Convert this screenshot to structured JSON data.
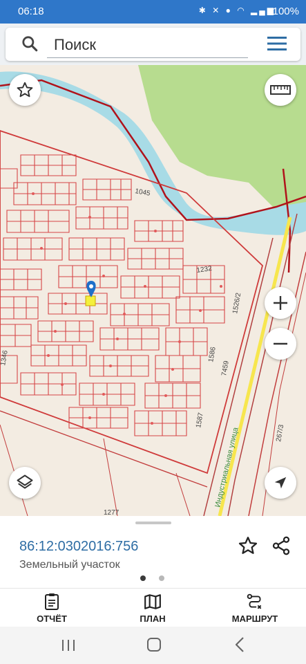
{
  "status_bar": {
    "time": "06:18",
    "icons": [
      "bluetooth-icon",
      "mute-icon",
      "location-icon",
      "wifi-icon",
      "signal-icon-1",
      "signal-icon-2"
    ],
    "battery": "100%"
  },
  "search": {
    "placeholder": "Поиск"
  },
  "map": {
    "labels": [
      "1045",
      "1232",
      "1526/2",
      "1586",
      "7459",
      "1587",
      "1346",
      "1277",
      "267/3"
    ],
    "street_name": "Индустриальная улица",
    "colors": {
      "parcel_border": "#d33b3b",
      "district_border": "#b0121b",
      "river": "#a8dbe6",
      "forest": "#b7dc8f",
      "road": "#f7e64e",
      "selected_parcel": "#f4f03c",
      "pin": "#1e6fc9"
    }
  },
  "panel": {
    "cadastral_number": "86:12:0302016:756",
    "parcel_type": "Земельный участок"
  },
  "actions": {
    "report": "ОТЧЁТ",
    "plan": "ПЛАН",
    "route": "МАРШРУТ"
  },
  "colors": {
    "status_bar": "#2f77c9",
    "accent": "#2e6da4"
  }
}
